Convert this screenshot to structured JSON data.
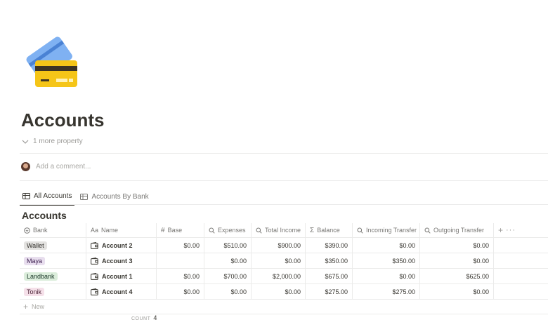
{
  "page": {
    "title": "Accounts",
    "more_property": "1 more property",
    "comment_placeholder": "Add a comment..."
  },
  "tabs": [
    {
      "label": "All Accounts",
      "active": true
    },
    {
      "label": "Accounts By Bank",
      "active": false
    }
  ],
  "database": {
    "title": "Accounts",
    "columns": [
      "Bank",
      "Name",
      "Base",
      "Expenses",
      "Total Income",
      "Balance",
      "Incoming Transfer",
      "Outgoing Transfer"
    ],
    "rows": [
      {
        "bank": "Wallet",
        "bank_color": "#e3e2e0",
        "bank_text": "#32302c",
        "name": "Account 2",
        "base": "$0.00",
        "expenses": "$510.00",
        "total_income": "$900.00",
        "balance": "$390.00",
        "incoming": "$0.00",
        "outgoing": "$0.00"
      },
      {
        "bank": "Maya",
        "bank_color": "#e8deee",
        "bank_text": "#412454",
        "name": "Account 3",
        "base": "",
        "expenses": "$0.00",
        "total_income": "$0.00",
        "balance": "$350.00",
        "incoming": "$350.00",
        "outgoing": "$0.00"
      },
      {
        "bank": "Landbank",
        "bank_color": "#dbeddb",
        "bank_text": "#1c3829",
        "name": "Account 1",
        "base": "$0.00",
        "expenses": "$700.00",
        "total_income": "$2,000.00",
        "balance": "$675.00",
        "incoming": "$0.00",
        "outgoing": "$625.00"
      },
      {
        "bank": "Tonik",
        "bank_color": "#f5e0e9",
        "bank_text": "#4c2337",
        "name": "Account 4",
        "base": "$0.00",
        "expenses": "$0.00",
        "total_income": "$0.00",
        "balance": "$275.00",
        "incoming": "$275.00",
        "outgoing": "$0.00"
      }
    ],
    "new_label": "New",
    "count_label": "COUNT",
    "count_value": "4"
  },
  "icons": {
    "page": "credit-cards-icon",
    "bank_col": "select-icon",
    "name_col": "text-property-icon",
    "base_col": "number-icon",
    "expenses_col": "rollup-search-icon",
    "income_col": "rollup-search-icon",
    "balance_col": "formula-sigma-icon",
    "incoming_col": "rollup-search-icon",
    "outgoing_col": "rollup-search-icon",
    "row_page": "wallet-page-icon"
  }
}
